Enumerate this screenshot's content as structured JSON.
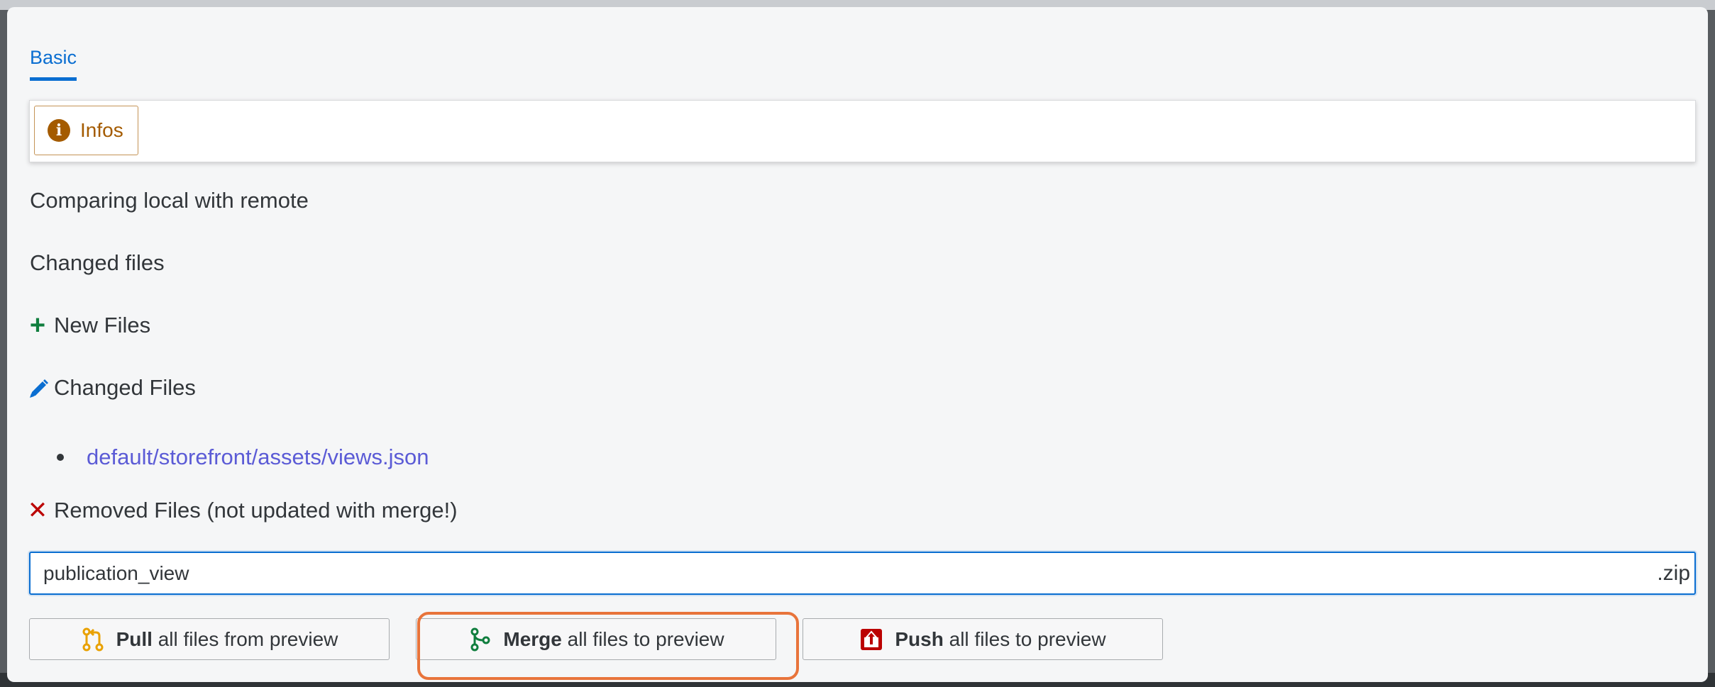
{
  "tabs": [
    {
      "label": "Basic",
      "active": true
    }
  ],
  "infos": {
    "label": "Infos"
  },
  "content": {
    "comparing": "Comparing local with remote",
    "changed_files_heading": "Changed files",
    "new_files": "New Files",
    "changed_files": "Changed Files",
    "changed_list": [
      "default/storefront/assets/views.json"
    ],
    "removed_files": "Removed Files (not updated with merge!)"
  },
  "filename": {
    "value": "publication_view",
    "suffix": ".zip"
  },
  "actions": {
    "pull": {
      "bold": "Pull",
      "rest": "all files from preview"
    },
    "merge": {
      "bold": "Merge",
      "rest": "all files to preview"
    },
    "push": {
      "bold": "Push",
      "rest": "all files to preview"
    }
  },
  "colors": {
    "accent": "#0a6ed1",
    "info": "#a45b00",
    "positive": "#107e3e",
    "negative": "#bb0000",
    "link": "#5b5bd6",
    "highlight": "#e8743b"
  },
  "icons": {
    "info": "info-circle-icon",
    "new": "plus-icon",
    "changed": "pencil-icon",
    "removed": "x-icon",
    "pull": "pull-request-icon",
    "merge": "branch-merge-icon",
    "push": "upload-icon"
  }
}
